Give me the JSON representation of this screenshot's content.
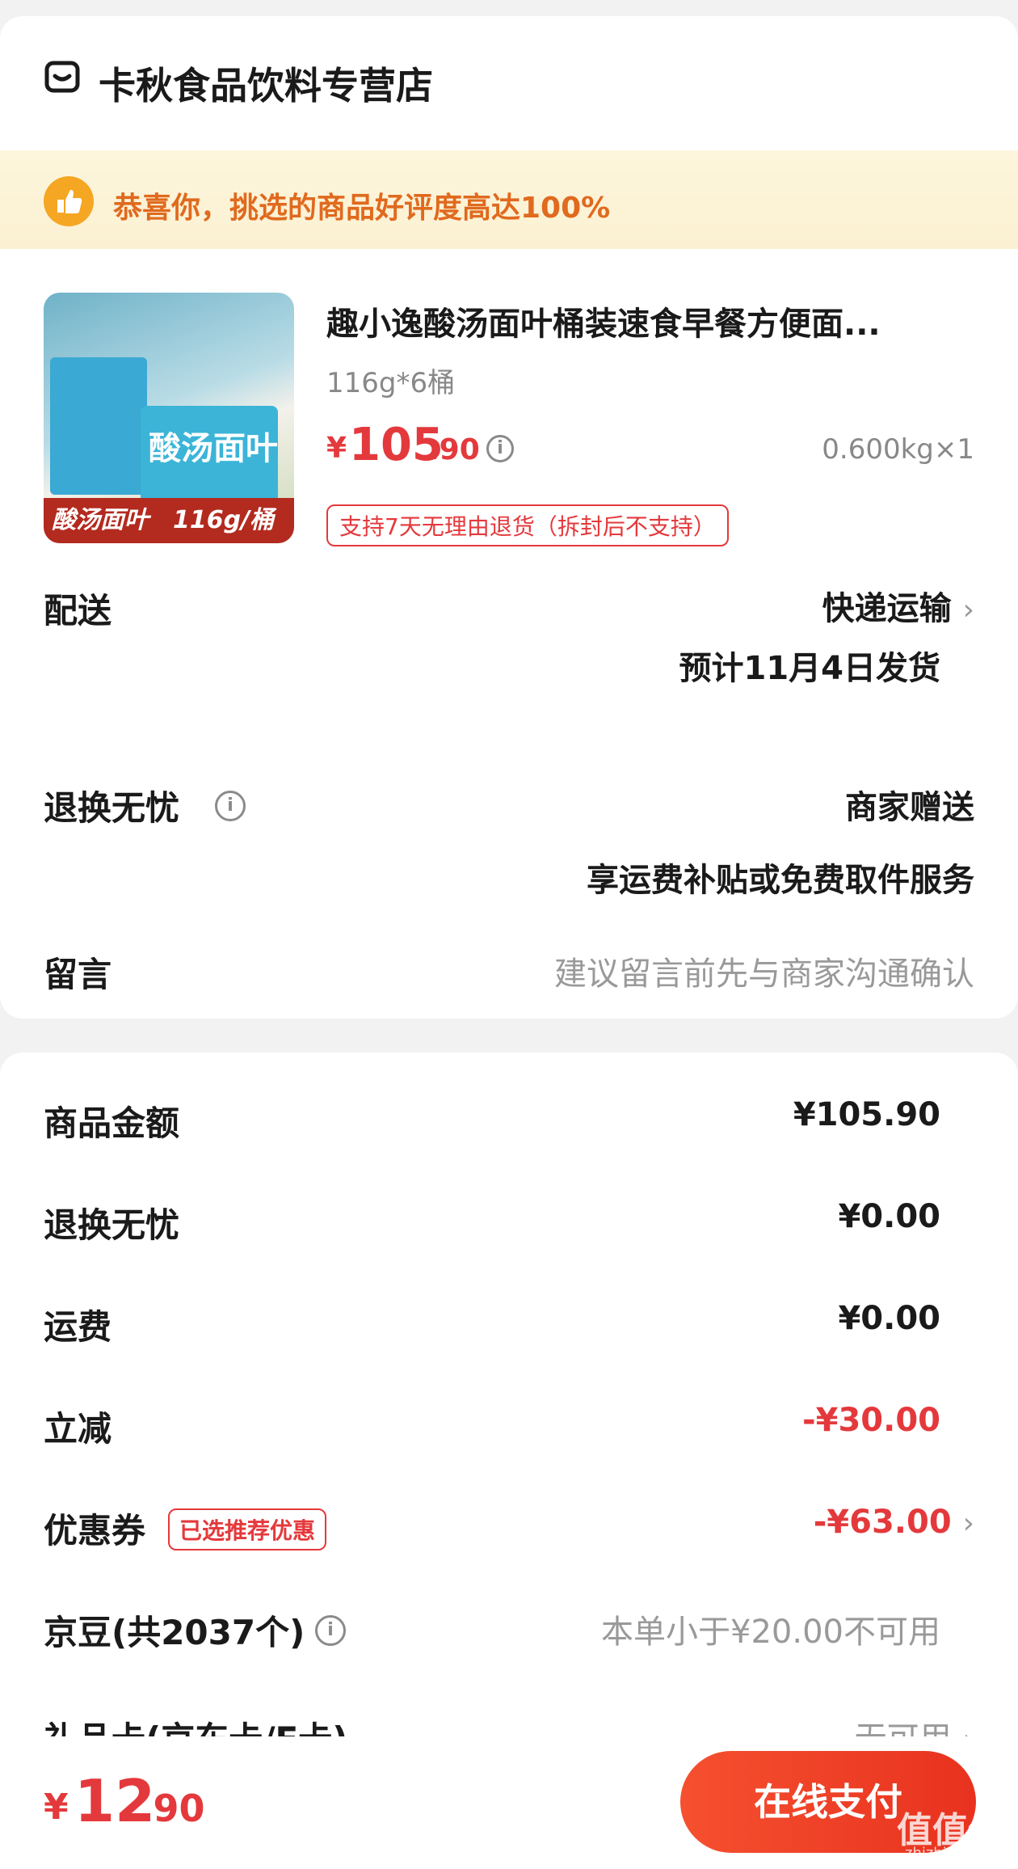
{
  "store": {
    "name": "卡秋食品饮料专营店",
    "icon": "store-icon"
  },
  "banner": {
    "text": "恭喜你，挑选的商品好评度高达100%",
    "icon": "thumbs-up-icon"
  },
  "product": {
    "image_label": "酸汤面叶　116g/桶",
    "image_cup_text": "酸汤面叶",
    "title": "趣小逸酸汤面叶桶装速食早餐方便面...",
    "spec": "116g*6桶",
    "price_symbol": "¥",
    "price_int": "105",
    "price_dec": ".90",
    "weight_qty": "0.600kg×1",
    "return_tag": "支持7天无理由退货（拆封后不支持）"
  },
  "delivery": {
    "label": "配送",
    "method": "快递运输",
    "eta": "预计11月4日发货"
  },
  "worry_free": {
    "label": "退换无忧",
    "value": "商家赠送",
    "desc": "享运费补贴或免费取件服务"
  },
  "message": {
    "label": "留言",
    "placeholder": "建议留言前先与商家沟通确认"
  },
  "summary": [
    {
      "label": "商品金额",
      "value": "¥105.90"
    },
    {
      "label": "退换无忧",
      "value": "¥0.00"
    },
    {
      "label": "运费",
      "value": "¥0.00"
    },
    {
      "label": "立减",
      "value": "-¥30.00"
    },
    {
      "label": "优惠券",
      "tag": "已选推荐优惠",
      "value": "-¥63.00"
    },
    {
      "label": "京豆(共2037个)",
      "value": "本单小于¥20.00不可用"
    },
    {
      "label": "礼品卡(京东卡/E卡)",
      "value": "无可用"
    }
  ],
  "footer": {
    "symbol": "¥",
    "int": "12",
    "dec": ".90",
    "pay_label": "在线支付",
    "watermark": "值值值",
    "watermark_sub": "zhizhizhi.com"
  },
  "colors": {
    "accent_red": "#e4393c",
    "banner_orange": "#e06a1e",
    "pay_button": "#f04a2a"
  }
}
